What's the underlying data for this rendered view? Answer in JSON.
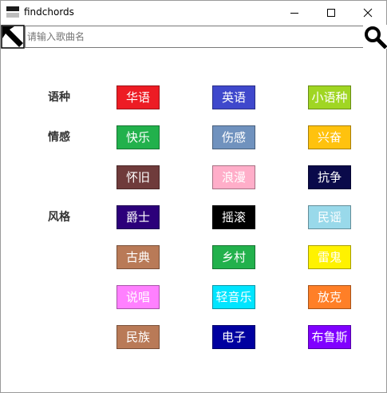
{
  "window": {
    "title": "findchords"
  },
  "search": {
    "placeholder": "请输入歌曲名",
    "value": "请输入歌曲名"
  },
  "labels": {
    "language": "语种",
    "emotion": "情感",
    "style": "风格"
  },
  "tags": {
    "huayu": {
      "text": "华语",
      "color": "#ed1c24"
    },
    "yingyu": {
      "text": "英语",
      "color": "#3f48cc"
    },
    "xiaoyuzhong": {
      "text": "小语种",
      "color": "#a0d623"
    },
    "kuaile": {
      "text": "快乐",
      "color": "#22b14c"
    },
    "shanggan": {
      "text": "伤感",
      "color": "#7092be"
    },
    "xingfen": {
      "text": "兴奋",
      "color": "#ffc20e"
    },
    "huaijiu": {
      "text": "怀旧",
      "color": "#6f3b3b"
    },
    "langman": {
      "text": "浪漫",
      "color": "#ffaec9"
    },
    "kangzheng": {
      "text": "抗争",
      "color": "#0a0a4a"
    },
    "jueshi": {
      "text": "爵士",
      "color": "#2c007a"
    },
    "yaogun": {
      "text": "摇滚",
      "color": "#000000"
    },
    "minyao": {
      "text": "民谣",
      "color": "#99d9ea"
    },
    "gudian": {
      "text": "古典",
      "color": "#b97a57"
    },
    "xiangcun": {
      "text": "乡村",
      "color": "#22b14c"
    },
    "leigui": {
      "text": "雷鬼",
      "color": "#fff200"
    },
    "shuochang": {
      "text": "说唱",
      "color": "#ff80ff"
    },
    "qingyinyue": {
      "text": "轻音乐",
      "color": "#00e5ff"
    },
    "fangke": {
      "text": "放克",
      "color": "#ff7f27"
    },
    "minzu": {
      "text": "民族",
      "color": "#b97a57"
    },
    "dianzi": {
      "text": "电子",
      "color": "#0000a0"
    },
    "bulusi": {
      "text": "布鲁斯",
      "color": "#8000ff"
    }
  }
}
